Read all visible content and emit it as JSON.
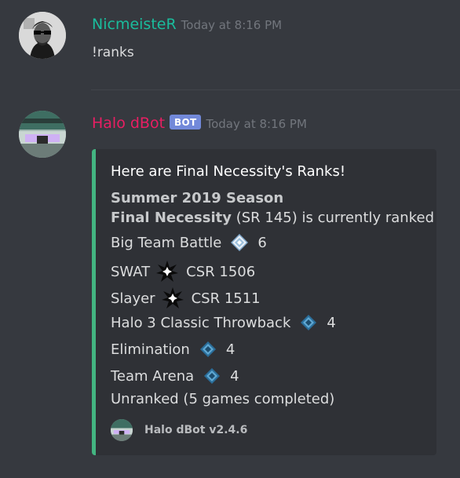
{
  "messages": [
    {
      "username": "NicmeisteR",
      "username_color": "#1abc9c",
      "timestamp": "Today at 8:16 PM",
      "text": "!ranks"
    },
    {
      "username": "Halo dBot",
      "username_color": "#e91e63",
      "bot_tag": "BOT",
      "timestamp": "Today at 8:16 PM"
    }
  ],
  "embed": {
    "accent_color": "#43b581",
    "title": "Here are Final Necessity's Ranks!",
    "season": "Summer 2019 Season",
    "player_name": "Final Necessity",
    "player_status": "(SR 145) is currently ranked",
    "ranks": [
      {
        "playlist": "Big Team Battle",
        "icon": "diamond-rank-icon",
        "value": "6"
      },
      {
        "playlist": "SWAT",
        "icon": "champion-rank-icon",
        "value": "CSR 1506"
      },
      {
        "playlist": "Slayer",
        "icon": "champion-rank-icon",
        "value": "CSR 1511"
      },
      {
        "playlist": "Halo 3 Classic Throwback",
        "icon": "platinum-rank-icon",
        "value": "4"
      },
      {
        "playlist": "Elimination",
        "icon": "platinum-rank-icon",
        "value": "4"
      },
      {
        "playlist": "Team Arena",
        "icon": "platinum-rank-icon",
        "value": "4"
      }
    ],
    "unranked_text": "Unranked (5 games completed)",
    "footer_text": "Halo dBot v2.4.6"
  }
}
